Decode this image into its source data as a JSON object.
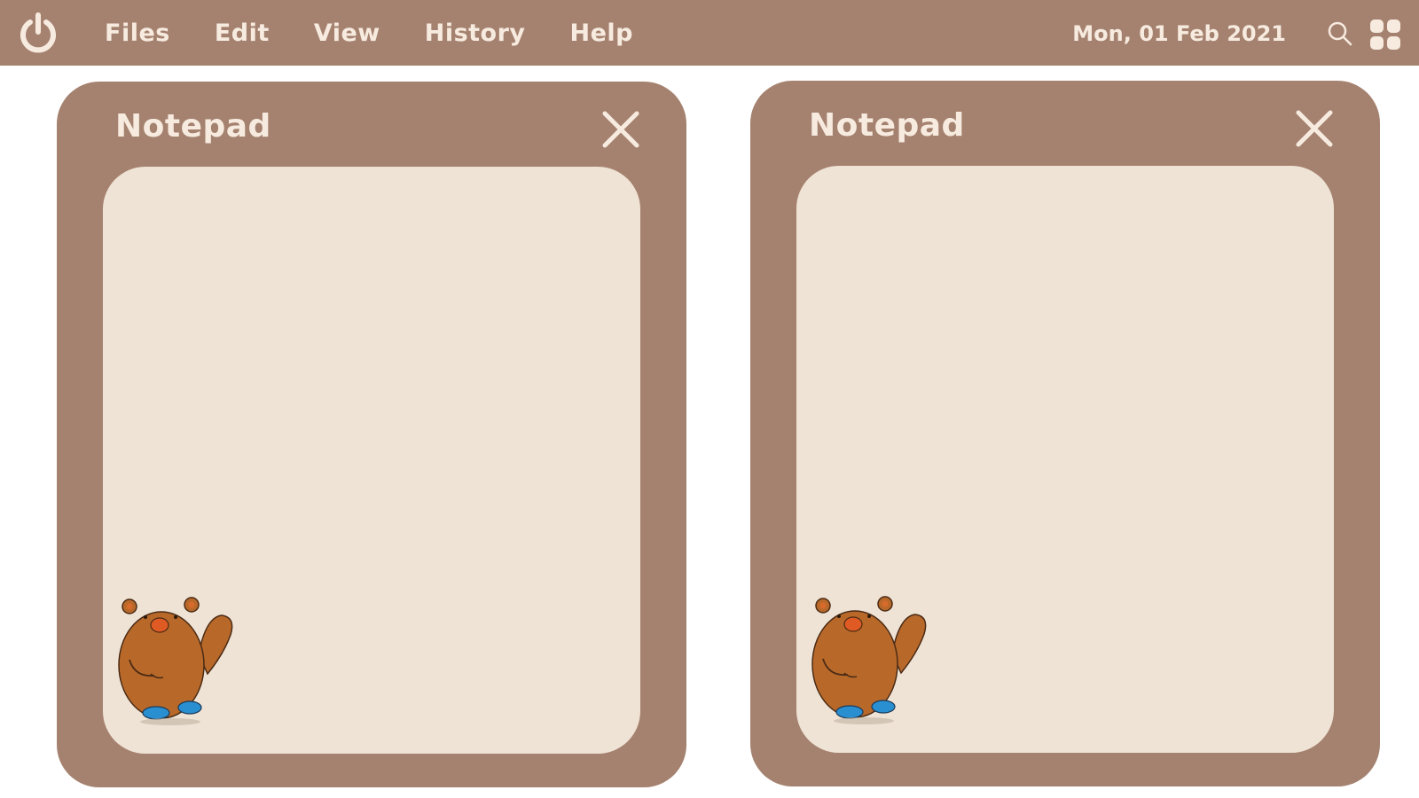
{
  "menubar": {
    "items": [
      "Files",
      "Edit",
      "View",
      "History",
      "Help"
    ],
    "date": "Mon, 01 Feb 2021",
    "icons": {
      "power": "power-icon",
      "search": "search-icon",
      "apps": "grid-icon"
    }
  },
  "windows": [
    {
      "title": "Notepad",
      "content": ""
    },
    {
      "title": "Notepad",
      "content": ""
    }
  ],
  "colors": {
    "frame": "#a5826f",
    "paper": "#efe3d5",
    "text": "#f7ebe0",
    "bear": "#b8692a"
  }
}
